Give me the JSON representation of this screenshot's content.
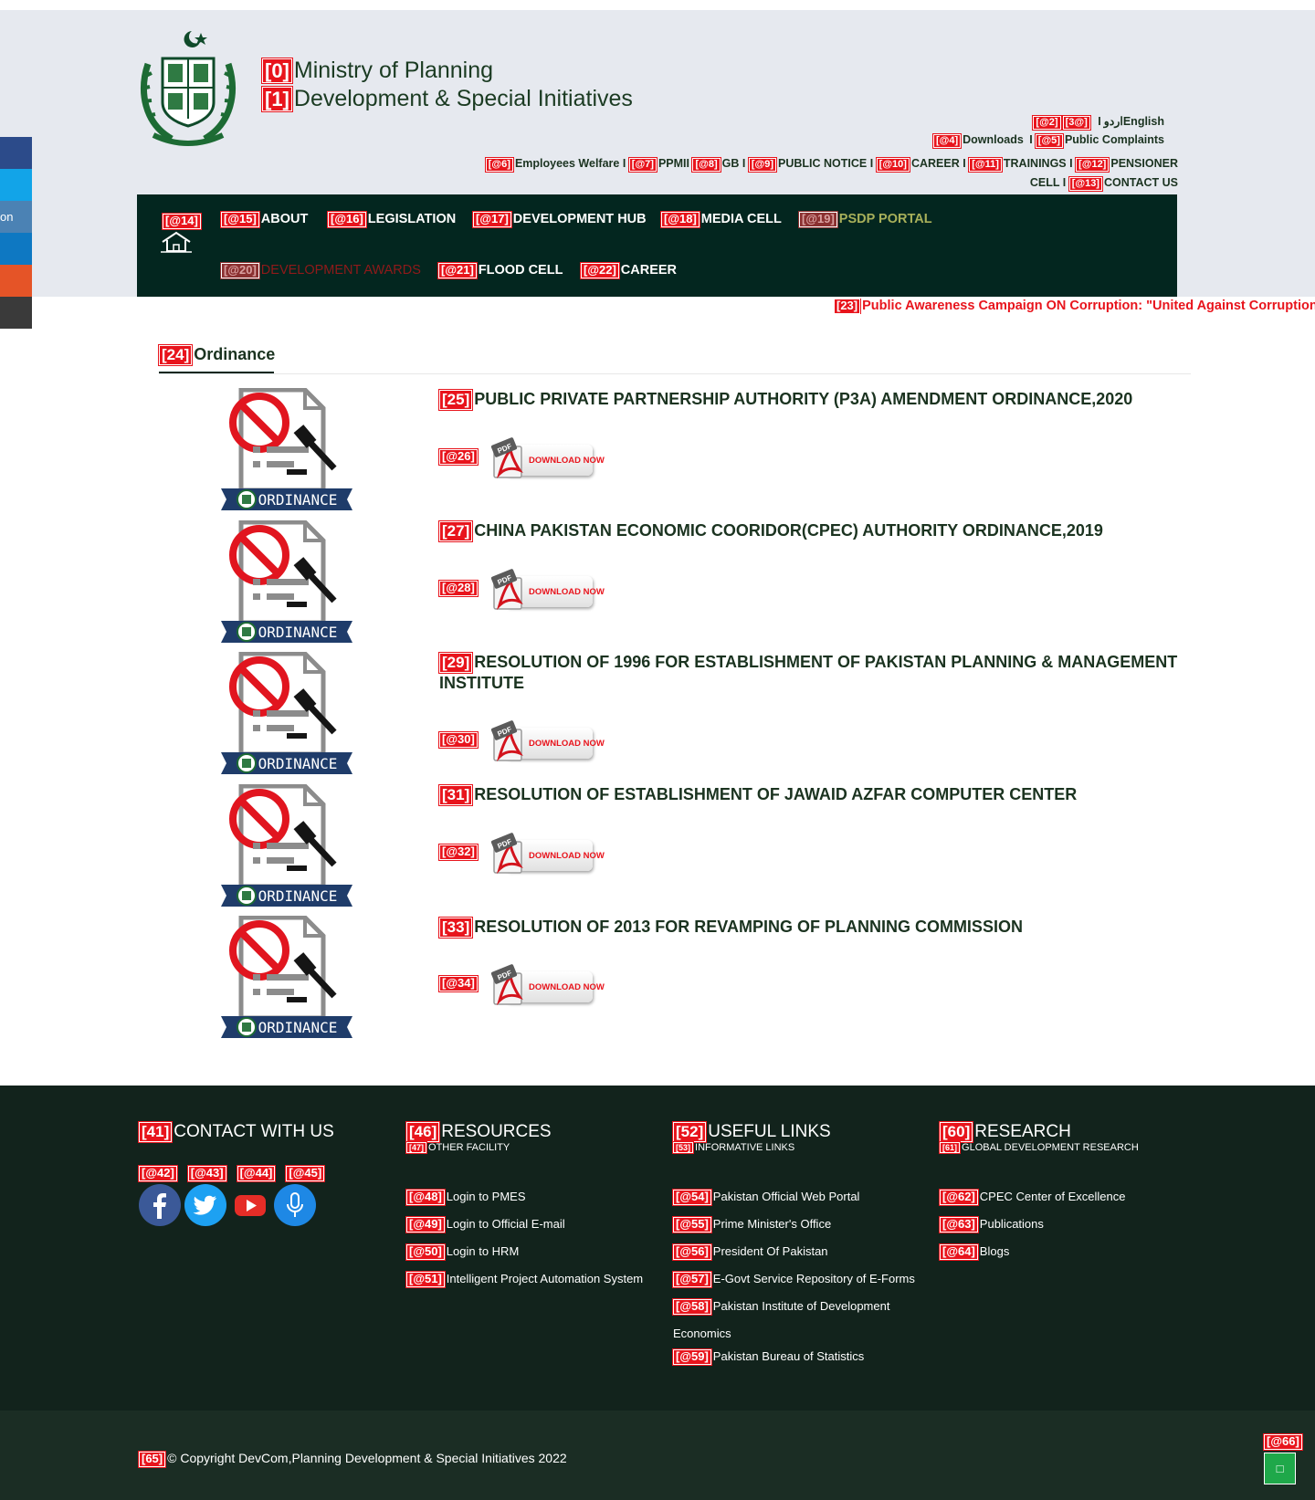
{
  "header": {
    "tag_title1": "[0]",
    "title_line1": "Ministry of Planning",
    "tag_title2": "[1]",
    "title_line2": "Development & Special Initiatives",
    "lang": {
      "tag_a": "[@2]",
      "tag_b": "[3@]",
      "urdu": "اردو",
      "sep": "I",
      "english": "English"
    },
    "row2": {
      "tag_downloads": "[@4]",
      "downloads": "Downloads",
      "sep": "I",
      "tag_complaints": "[@5]",
      "complaints": "Public Complaints"
    },
    "row3": [
      {
        "tag": "[@6]",
        "label": "Employees Welfare I"
      },
      {
        "tag": "[@7]",
        "label": "PPMII"
      },
      {
        "tag": "[@8]",
        "label": "GB I"
      },
      {
        "tag": "[@9]",
        "label": "PUBLIC NOTICE I"
      },
      {
        "tag": "[@10]",
        "label": "CAREER I"
      },
      {
        "tag": "[@11]",
        "label": "TRAININGS I"
      },
      {
        "tag": "[@12]",
        "label": "PENSIONER"
      }
    ],
    "row4": {
      "cell_text": "CELL I",
      "tag_contact": "[@13]",
      "contact": "CONTACT US"
    }
  },
  "sidebar": {
    "partial_label": "on",
    "colors": [
      "#2c4b8a",
      "#12a4e8",
      "#4b82b4",
      "#0e78c2",
      "#e55427",
      "#3a3a3a"
    ]
  },
  "nav": {
    "home_tag": "[@14]",
    "items": [
      {
        "tag": "[@15]",
        "label": "ABOUT"
      },
      {
        "tag": "[@16]",
        "label": "LEGISLATION"
      },
      {
        "tag": "[@17]",
        "label": "DEVELOPMENT HUB"
      },
      {
        "tag": "[@18]",
        "label": "MEDIA CELL"
      },
      {
        "tag": "[@19]",
        "label": "PSDP PORTAL"
      },
      {
        "tag": "[@20]",
        "label": "DEVELOPMENT AWARDS"
      },
      {
        "tag": "[@21]",
        "label": "FLOOD CELL"
      },
      {
        "tag": "[@22]",
        "label": "CAREER"
      }
    ]
  },
  "marquee": {
    "tag": "[23]",
    "text": "Public Awareness Campaign ON Corruption: \"United Against Corruption fo"
  },
  "section": {
    "tag": "[24]",
    "title": "Ordinance"
  },
  "ordinance_badge": "ORDINANCE",
  "download_label": "DOWNLOAD NOW",
  "pdf_label": "PDF",
  "ordinances": [
    {
      "tag": "[25]",
      "title": "PUBLIC PRIVATE PARTNERSHIP AUTHORITY (P3A) AMENDMENT ORDINANCE,2020",
      "dl_tag": "[@26]"
    },
    {
      "tag": "[27]",
      "title": "CHINA PAKISTAN ECONOMIC COORIDOR(CPEC) AUTHORITY ORDINANCE,2019",
      "dl_tag": "[@28]"
    },
    {
      "tag": "[29]",
      "title": "RESOLUTION OF 1996 FOR ESTABLISHMENT OF PAKISTAN PLANNING & MANAGEMENT INSTITUTE",
      "dl_tag": "[@30]"
    },
    {
      "tag": "[31]",
      "title": "RESOLUTION OF ESTABLISHMENT OF JAWAID AZFAR COMPUTER CENTER",
      "dl_tag": "[@32]"
    },
    {
      "tag": "[33]",
      "title": "RESOLUTION OF 2013 FOR REVAMPING OF PLANNING COMMISSION",
      "dl_tag": "[@34]"
    }
  ],
  "footer": {
    "contact": {
      "tag": "[41]",
      "title": "CONTACT WITH US",
      "social_tags": [
        "[@42]",
        "[@43]",
        "[@44]",
        "[@45]"
      ]
    },
    "resources": {
      "tag": "[46]",
      "title": "RESOURCES",
      "sub_tag": "[47]",
      "sub": "OTHER FACILITY",
      "links": [
        {
          "tag": "[@48]",
          "label": "Login to PMES"
        },
        {
          "tag": "[@49]",
          "label": "Login to Official E-mail"
        },
        {
          "tag": "[@50]",
          "label": "Login to HRM"
        },
        {
          "tag": "[@51]",
          "label": "Intelligent Project Automation System"
        }
      ]
    },
    "useful": {
      "tag": "[52]",
      "title": "USEFUL LINKS",
      "sub_tag": "[53]",
      "sub": "INFORMATIVE LINKS",
      "links": [
        {
          "tag": "[@54]",
          "label": "Pakistan Official Web Portal"
        },
        {
          "tag": "[@55]",
          "label": "Prime Minister's Office"
        },
        {
          "tag": "[@56]",
          "label": "President Of Pakistan"
        },
        {
          "tag": "[@57]",
          "label": "E-Govt Service Repository of E-Forms"
        },
        {
          "tag": "[@58]",
          "label": "Pakistan Institute of Development Economics"
        },
        {
          "tag": "[@59]",
          "label": "Pakistan Bureau of Statistics"
        }
      ]
    },
    "research": {
      "tag": "[60]",
      "title": "RESEARCH",
      "sub_tag": "[61]",
      "sub": "GLOBAL DEVELOPMENT RESEARCH",
      "links": [
        {
          "tag": "[@62]",
          "label": "CPEC Center of Excellence"
        },
        {
          "tag": "[@63]",
          "label": "Publications"
        },
        {
          "tag": "[@64]",
          "label": "Blogs"
        }
      ]
    },
    "copyright_tag": "[65]",
    "copyright": "© Copyright DevCom,Planning Development & Special Initiatives 2022",
    "totop_tag": "[@66]",
    "totop_glyph": "□"
  }
}
